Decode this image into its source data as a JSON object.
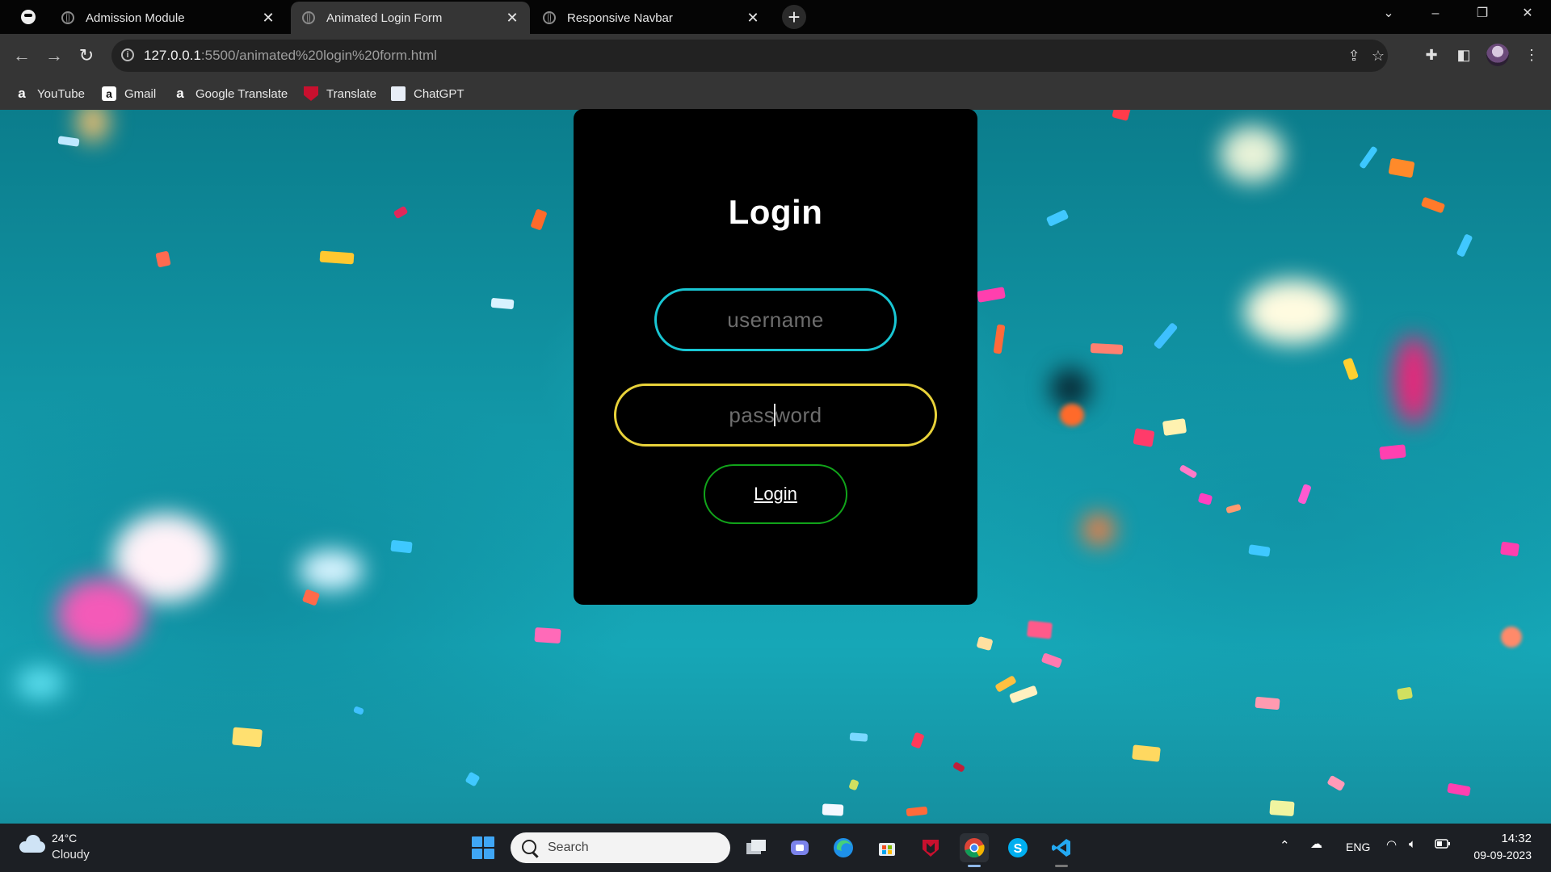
{
  "tabs": [
    {
      "title": "Admission Module",
      "close": "✕"
    },
    {
      "title": "Animated Login Form",
      "close": "✕"
    },
    {
      "title": "Responsive Navbar",
      "close": "✕"
    }
  ],
  "new_tab": "+",
  "window_controls": {
    "dropdown": "⌄",
    "minimize": "–",
    "restore": "❐",
    "close": "✕"
  },
  "nav": {
    "back": "←",
    "forward": "→",
    "reload": "↻"
  },
  "address": {
    "host": "127.0.0.1",
    "path": ":5500/animated%20login%20form.html"
  },
  "bookmarks": [
    {
      "label": "YouTube",
      "icon": "a"
    },
    {
      "label": "Gmail",
      "icon": "a"
    },
    {
      "label": "Google Translate",
      "icon": "a"
    },
    {
      "label": "Translate",
      "icon": ""
    },
    {
      "label": "ChatGPT",
      "icon": ""
    }
  ],
  "login": {
    "title": "Login",
    "username_placeholder": "username",
    "password_before_caret": "pass",
    "password_after_caret": "word",
    "button": "Login"
  },
  "colors": {
    "username_border": "#19c6d3",
    "password_border": "#e8d23a",
    "button_border": "#11a31a"
  },
  "taskbar": {
    "weather_temp": "24°C",
    "weather_desc": "Cloudy",
    "search_label": "Search",
    "tray_language": "ENG",
    "time": "14:32",
    "date": "09-09-2023"
  }
}
